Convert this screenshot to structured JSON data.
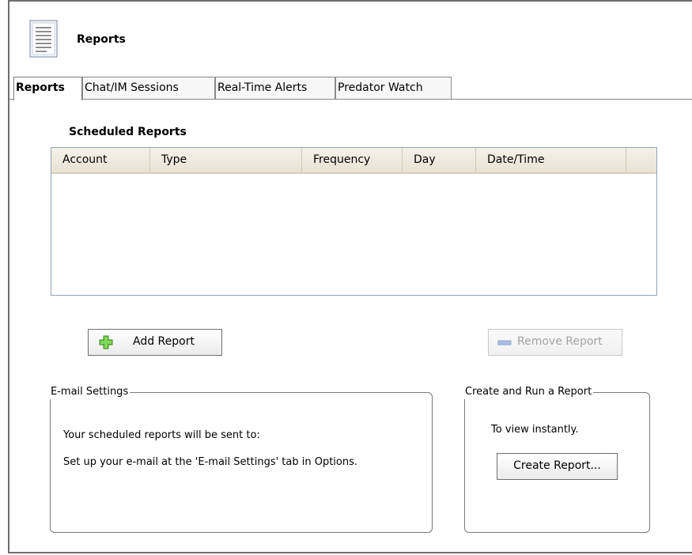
{
  "header": {
    "title": "Reports",
    "icon": "document-icon"
  },
  "tabs": [
    {
      "label": "Reports",
      "active": true
    },
    {
      "label": "Chat/IM Sessions",
      "active": false
    },
    {
      "label": "Real-Time Alerts",
      "active": false
    },
    {
      "label": "Predator Watch",
      "active": false
    }
  ],
  "scheduled": {
    "title": "Scheduled Reports",
    "columns": [
      "Account",
      "Type",
      "Frequency",
      "Day",
      "Date/Time"
    ],
    "rows": []
  },
  "actions": {
    "add_label": "Add Report",
    "add_icon": "plus-icon",
    "remove_label": "Remove Report",
    "remove_icon": "minus-icon"
  },
  "email": {
    "legend": "E-mail Settings",
    "line1": "Your scheduled reports will be sent to:",
    "line2": "Set up your e-mail at the 'E-mail Settings' tab in Options."
  },
  "create": {
    "legend": "Create and Run a Report",
    "subtitle": "To view instantly.",
    "button_label": "Create Report..."
  },
  "colors": {
    "accent_green": "#4caf2a",
    "disabled_blue": "#9fb6d8",
    "header_bg": "#f0ece0"
  }
}
